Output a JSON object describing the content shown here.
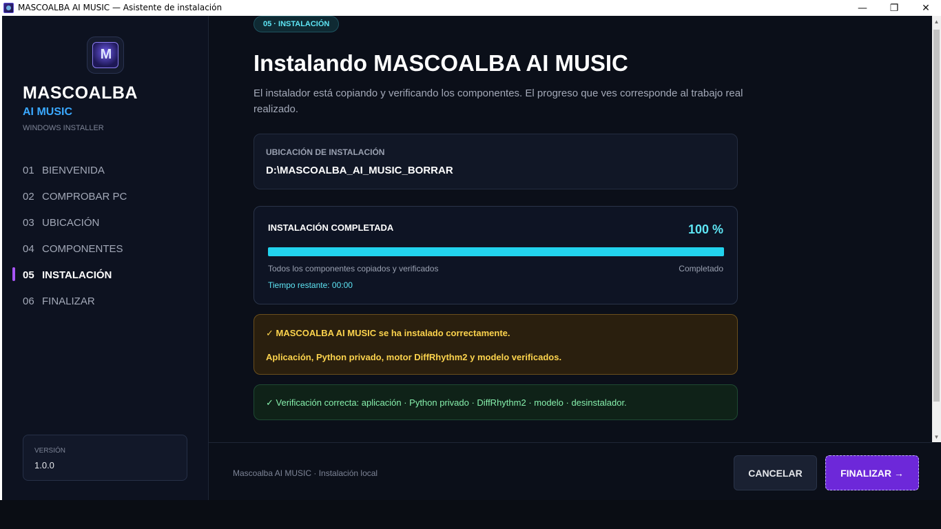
{
  "window": {
    "title": "MASCOALBA AI MUSIC — Asistente de instalación",
    "minimize_icon": "—",
    "maximize_icon": "❐",
    "close_icon": "✕"
  },
  "sidebar": {
    "brand_line1": "MASCOALBA",
    "brand_line2": "AI MUSIC",
    "brand_line3": "WINDOWS INSTALLER",
    "steps": [
      {
        "num": "01",
        "label": "BIENVENIDA"
      },
      {
        "num": "02",
        "label": "COMPROBAR PC"
      },
      {
        "num": "03",
        "label": "UBICACIÓN"
      },
      {
        "num": "04",
        "label": "COMPONENTES"
      },
      {
        "num": "05",
        "label": "INSTALACIÓN"
      },
      {
        "num": "06",
        "label": "FINALIZAR"
      }
    ],
    "active_step": 5,
    "version_label": "VERSIÓN",
    "version_value": "1.0.0"
  },
  "main": {
    "badge": "05 · INSTALACIÓN",
    "title": "Instalando MASCOALBA AI MUSIC",
    "description": "El instalador está copiando y verificando los componentes. El progreso que ves corresponde al trabajo real realizado.",
    "location": {
      "label": "UBICACIÓN DE INSTALACIÓN",
      "value": "D:\\MASCOALBA_AI_MUSIC_BORRAR"
    },
    "progress": {
      "title": "INSTALACIÓN COMPLETADA",
      "percent_text": "100 %",
      "percent": 100,
      "detail": "Todos los componentes copiados y verificados",
      "status": "Completado",
      "time_remaining": "Tiempo restante: 00:00"
    },
    "success": {
      "line1": "✓ MASCOALBA AI MUSIC se ha instalado correctamente.",
      "line2": "Aplicación, Python privado, motor DiffRhythm2 y modelo verificados."
    },
    "verification": "✓ Verificación correcta: aplicación · Python privado · DiffRhythm2 · modelo · desinstalador."
  },
  "footer": {
    "text": "Mascoalba AI MUSIC · Instalación local",
    "cancel_label": "CANCELAR",
    "finish_label": "FINALIZAR →"
  },
  "colors": {
    "accent_cyan": "#22d3ee",
    "accent_purple": "#6d28d9",
    "active_indicator": "#a855f7",
    "success_yellow": "#fcd34d",
    "verify_green": "#86efac"
  }
}
